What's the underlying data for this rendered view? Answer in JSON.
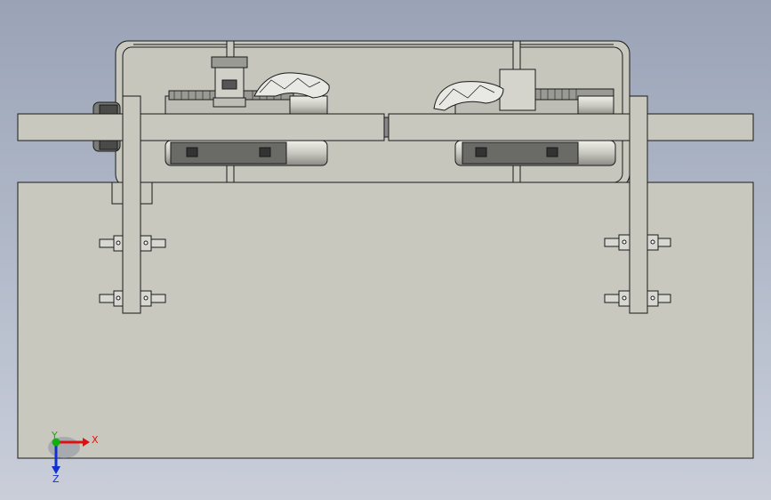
{
  "viewport": {
    "background_top": "#9aa3b6",
    "background_bottom": "#c9ced9",
    "part_fill": "#c8c8bf",
    "edge_color": "#1a1a1a",
    "motor_fill": "#d6d6cf"
  },
  "triad": {
    "x_label": "X",
    "y_label": "Y",
    "z_label": "Z",
    "x_color": "#e01010",
    "y_color": "#10b010",
    "z_color": "#1030d0"
  }
}
